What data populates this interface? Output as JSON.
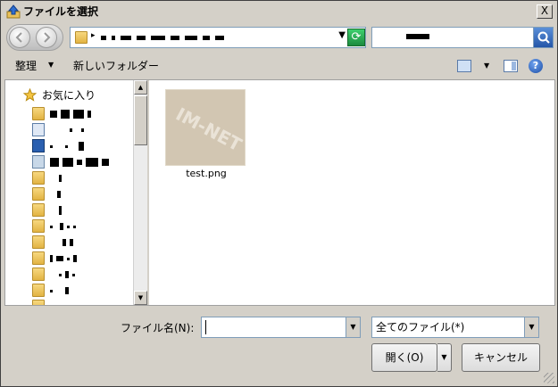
{
  "window": {
    "title": "ファイルを選択",
    "close_label": "X"
  },
  "address": {
    "dropdown_label": "▼",
    "refresh_label": "⟳"
  },
  "toolbar": {
    "organize_label": "整理",
    "organize_arrow": "▼",
    "new_folder_label": "新しいフォルダー",
    "views_arrow": "▼",
    "help_label": "?"
  },
  "nav": {
    "favorites_label": "お気に入り",
    "scroll_up": "▲",
    "scroll_down": "▼"
  },
  "files": [
    {
      "name": "test.png",
      "thumb_watermark": "IM-NET"
    }
  ],
  "bottom": {
    "filename_label": "ファイル名(N):",
    "filename_value": "",
    "filetype_value": "全てのファイル(*)",
    "open_label": "開く(O)",
    "open_drop": "▼",
    "cancel_label": "キャンセル",
    "combo_arrow": "▼"
  },
  "colors": {
    "dialog_bg": "#d4d0c8",
    "accent": "#1e4fa6",
    "folder": "#e2b343"
  }
}
